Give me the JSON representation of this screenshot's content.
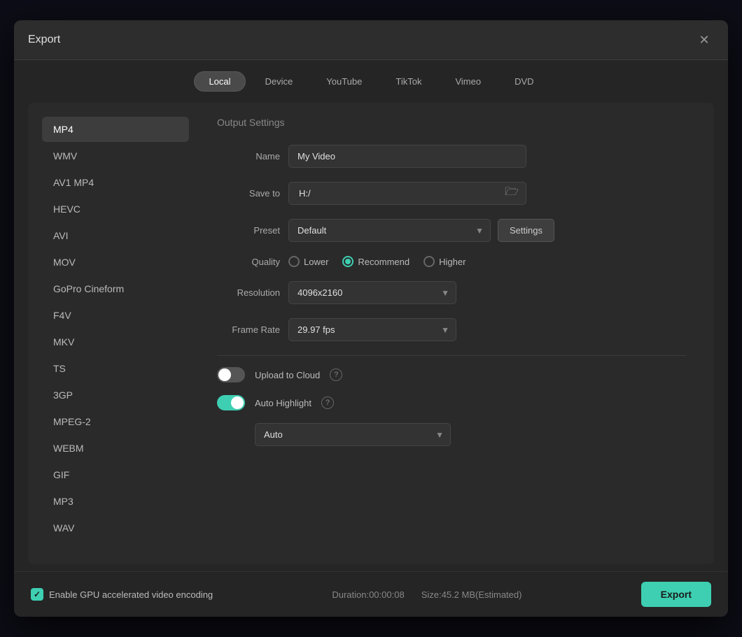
{
  "dialog": {
    "title": "Export",
    "close_label": "✕"
  },
  "tabs": [
    {
      "id": "local",
      "label": "Local",
      "active": true
    },
    {
      "id": "device",
      "label": "Device",
      "active": false
    },
    {
      "id": "youtube",
      "label": "YouTube",
      "active": false
    },
    {
      "id": "tiktok",
      "label": "TikTok",
      "active": false
    },
    {
      "id": "vimeo",
      "label": "Vimeo",
      "active": false
    },
    {
      "id": "dvd",
      "label": "DVD",
      "active": false
    }
  ],
  "formats": [
    {
      "id": "mp4",
      "label": "MP4",
      "active": true
    },
    {
      "id": "wmv",
      "label": "WMV",
      "active": false
    },
    {
      "id": "av1mp4",
      "label": "AV1 MP4",
      "active": false
    },
    {
      "id": "hevc",
      "label": "HEVC",
      "active": false
    },
    {
      "id": "avi",
      "label": "AVI",
      "active": false
    },
    {
      "id": "mov",
      "label": "MOV",
      "active": false
    },
    {
      "id": "gopro",
      "label": "GoPro Cineform",
      "active": false
    },
    {
      "id": "f4v",
      "label": "F4V",
      "active": false
    },
    {
      "id": "mkv",
      "label": "MKV",
      "active": false
    },
    {
      "id": "ts",
      "label": "TS",
      "active": false
    },
    {
      "id": "3gp",
      "label": "3GP",
      "active": false
    },
    {
      "id": "mpeg2",
      "label": "MPEG-2",
      "active": false
    },
    {
      "id": "webm",
      "label": "WEBM",
      "active": false
    },
    {
      "id": "gif",
      "label": "GIF",
      "active": false
    },
    {
      "id": "mp3",
      "label": "MP3",
      "active": false
    },
    {
      "id": "wav",
      "label": "WAV",
      "active": false
    }
  ],
  "output_settings": {
    "section_title": "Output Settings",
    "name_label": "Name",
    "name_value": "My Video",
    "save_to_label": "Save to",
    "save_to_value": "H:/",
    "preset_label": "Preset",
    "preset_value": "Default",
    "settings_btn": "Settings",
    "quality_label": "Quality",
    "quality_options": [
      {
        "id": "lower",
        "label": "Lower",
        "active": false
      },
      {
        "id": "recommend",
        "label": "Recommend",
        "active": true
      },
      {
        "id": "higher",
        "label": "Higher",
        "active": false
      }
    ],
    "resolution_label": "Resolution",
    "resolution_value": "4096x2160",
    "frame_rate_label": "Frame Rate",
    "frame_rate_value": "29.97 fps",
    "upload_cloud_label": "Upload to Cloud",
    "upload_cloud_on": false,
    "auto_highlight_label": "Auto Highlight",
    "auto_highlight_on": true,
    "auto_highlight_dropdown": "Auto"
  },
  "footer": {
    "gpu_label": "Enable GPU accelerated video encoding",
    "duration_label": "Duration:00:00:08",
    "size_label": "Size:45.2 MB(Estimated)",
    "export_label": "Export"
  }
}
